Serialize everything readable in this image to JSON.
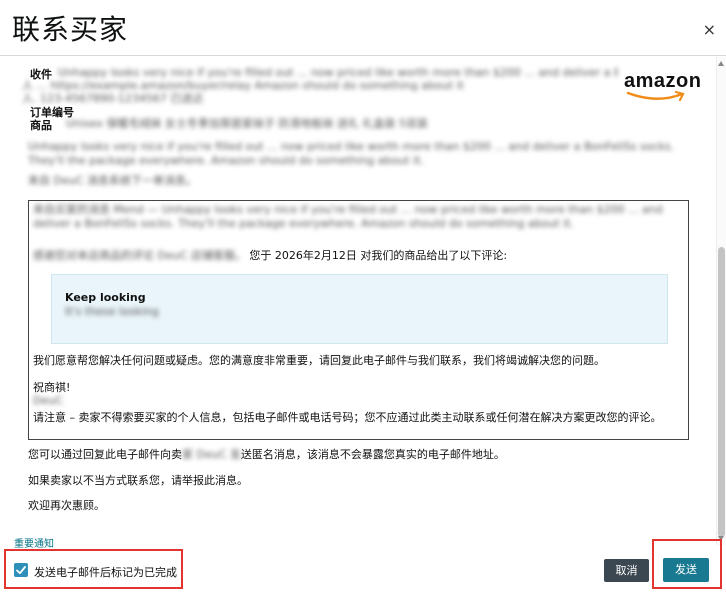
{
  "header": {
    "title": "联系买家",
    "close_glyph": "×"
  },
  "fields": {
    "to_label": "收件",
    "subject_label": "订单编号",
    "product_label": "商品"
  },
  "review": {
    "intro_suffix": "您于 2026年2月12日 对我们的商品给出了以下评论:",
    "headline": "Keep looking",
    "help_text": "我们愿意帮您解决任何问题或疑虑。您的满意度非常重要，请回复此电子邮件与我们联系，我们将竭诚解决您的问题。",
    "greeting": "祝商祺!",
    "notice": "请注意 – 卖家不得索要买家的个人信息，包括电子邮件或电话号码；您不应通过此类主动联系或任何潜在解决方案更改您的评论。"
  },
  "body_text": {
    "reply_prefix": "您可以通过回复此电子邮件向卖",
    "reply_suffix": "送匿名消息，该消息不会暴露您真实的电子邮件地址。",
    "report": "如果卖家以不当方式联系您，请举报此消息。",
    "welcome": "欢迎再次惠顾。"
  },
  "footer": {
    "notice_link": "重要通知",
    "mark_complete_label": "发送电子邮件后标记为已完成",
    "mark_complete_checked": true,
    "cancel_label": "取消",
    "send_label": "发送"
  },
  "colors": {
    "send_button": "#197991",
    "cancel_button": "#3b4751",
    "checkbox": "#2e8fb8",
    "highlight_box": "#e3342f",
    "link": "#007185"
  }
}
